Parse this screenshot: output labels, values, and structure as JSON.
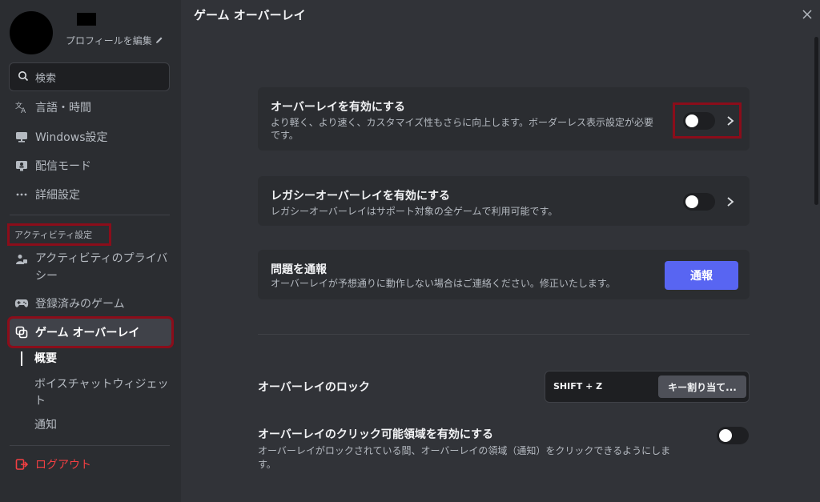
{
  "sidebar": {
    "edit_profile": "プロフィールを編集",
    "search_placeholder": "検索",
    "items": [
      {
        "label": "言語・時間",
        "icon": "language-icon"
      },
      {
        "label": "Windows設定",
        "icon": "monitor-icon"
      },
      {
        "label": "配信モード",
        "icon": "streamer-mode-icon"
      },
      {
        "label": "詳細設定",
        "icon": "more-icon"
      }
    ],
    "activity_header": "アクティビティ設定",
    "activity_items": [
      {
        "label": "アクティビティのプライバシー",
        "icon": "privacy-icon"
      },
      {
        "label": "登録済みのゲーム",
        "icon": "gamepad-icon"
      },
      {
        "label": "ゲーム オーバーレイ",
        "icon": "overlay-icon"
      }
    ],
    "subnav": [
      "概要",
      "ボイスチャットウィジェット",
      "通知"
    ],
    "logout": "ログアウト"
  },
  "main": {
    "title": "ゲーム オーバーレイ",
    "cards": [
      {
        "title": "オーバーレイを有効にする",
        "desc": "より軽く、より速く、カスタマイズ性もさらに向上します。ボーダーレス表示設定が必要です。",
        "enabled": false
      },
      {
        "title": "レガシーオーバーレイを有効にする",
        "desc": "レガシーオーバーレイはサポート対象の全ゲームで利用可能です。",
        "enabled": false
      },
      {
        "title": "問題を通報",
        "desc": "オーバーレイが予想通りに動作しない場合はご連絡ください。修正いたします。",
        "button": "通報"
      }
    ],
    "lock": {
      "label": "オーバーレイのロック",
      "keybind": "SHIFT + Z",
      "assign": "キー割り当て..."
    },
    "clickable": {
      "label": "オーバーレイのクリック可能領域を有効にする",
      "desc": "オーバーレイがロックされている間、オーバーレイの領域（通知）をクリックできるようにします。",
      "enabled": false
    }
  },
  "colors": {
    "accent": "#5865f2",
    "highlight": "#8b0d1a",
    "danger": "#f23f42"
  }
}
